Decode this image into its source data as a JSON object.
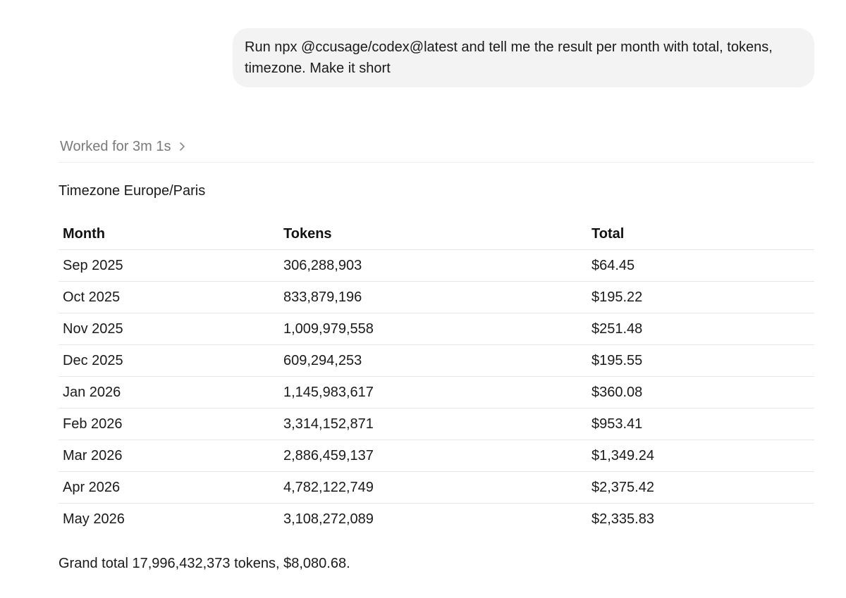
{
  "user_message": {
    "text": "Run npx @ccusage/codex@latest and tell me the result per month with total, tokens, timezone. Make it short"
  },
  "worked": {
    "label": "Worked for 3m 1s",
    "icon": "chevron-right-icon"
  },
  "response": {
    "timezone_line": "Timezone Europe/Paris",
    "table": {
      "headers": [
        "Month",
        "Tokens",
        "Total"
      ],
      "rows": [
        [
          "Sep 2025",
          "306,288,903",
          "$64.45"
        ],
        [
          "Oct 2025",
          "833,879,196",
          "$195.22"
        ],
        [
          "Nov 2025",
          "1,009,979,558",
          "$251.48"
        ],
        [
          "Dec 2025",
          "609,294,253",
          "$195.55"
        ],
        [
          "Jan 2026",
          "1,145,983,617",
          "$360.08"
        ],
        [
          "Feb 2026",
          "3,314,152,871",
          "$953.41"
        ],
        [
          "Mar 2026",
          "2,886,459,137",
          "$1,349.24"
        ],
        [
          "Apr 2026",
          "4,782,122,749",
          "$2,375.42"
        ],
        [
          "May 2026",
          "3,108,272,089",
          "$2,335.83"
        ]
      ]
    },
    "grand_total": "Grand total 17,996,432,373 tokens, $8,080.68."
  }
}
